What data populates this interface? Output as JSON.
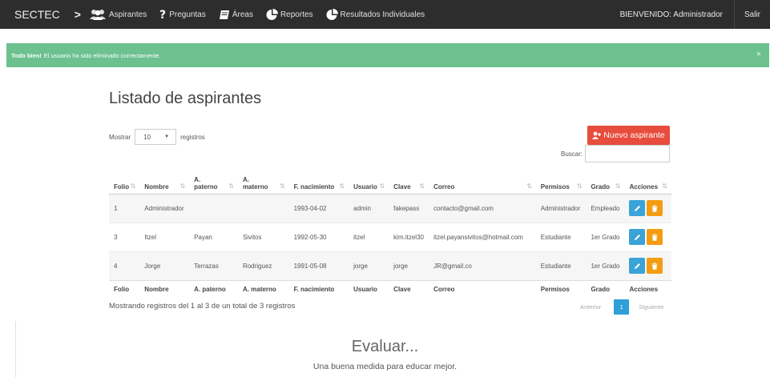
{
  "nav": {
    "brand": "SECTEC",
    "items": [
      {
        "label": "Aspirantes",
        "icon": "users-icon"
      },
      {
        "label": "Preguntas",
        "icon": "question-icon"
      },
      {
        "label": "Áreas",
        "icon": "book-icon"
      },
      {
        "label": "Reportes",
        "icon": "pie-chart-icon"
      },
      {
        "label": "Resultados Individuales",
        "icon": "pie-chart-icon"
      }
    ],
    "welcome": "BIENVENIDO: Administrador",
    "logout": "Salir"
  },
  "alert": {
    "title": "Todo bien!",
    "message": "El usuario ha sido eliminado correctamente.",
    "close": "×",
    "color": "#6cc18e"
  },
  "page": {
    "title": "Listado de aspirantes",
    "length_prefix": "Mostrar",
    "length_value": "10",
    "length_suffix": "registros",
    "new_button": "Nuevo aspirante",
    "search_label": "Buscar:",
    "search_value": ""
  },
  "table": {
    "headers": [
      "Folio",
      "Nombre",
      "A. paterno",
      "A. materno",
      "F. nacimiento",
      "Usuario",
      "Clave",
      "Correo",
      "Permisos",
      "Grado",
      "Acciones"
    ],
    "rows": [
      [
        "1",
        "Administrador",
        "",
        "",
        "1993-04-02",
        "admin",
        "fakepass",
        "contacto@gmail.com",
        "Administrador",
        "Empleado"
      ],
      [
        "3",
        "Itzel",
        "Payan",
        "Sivitos",
        "1992-05-30",
        "itzel",
        "kim.itzel30",
        "itzel.payansivitos@hotmail.com",
        "Estudiante",
        "1er Grado"
      ],
      [
        "4",
        "Jorge",
        "Terrazas",
        "Rodriguez",
        "1991-05-08",
        "jorge",
        "jorge",
        "JR@gmail.co",
        "Estudiante",
        "1er Grado"
      ]
    ],
    "footer": [
      "Folio",
      "Nombre",
      "A. paterno",
      "A. materno",
      "F. nacimiento",
      "Usuario",
      "Clave",
      "Correo",
      "Permisos",
      "Grado",
      "Acciones"
    ]
  },
  "info": "Mostrando registros del 1 al 3 de un total de 3 registros",
  "pager": {
    "prev": "Anterior",
    "current": "1",
    "next": "Siguiente"
  },
  "footer": {
    "title": "Evaluar...",
    "subtitle": "Una buena medida para educar mejor."
  },
  "colors": {
    "navbar": "#2d2d2d",
    "danger": "#e74c3c",
    "edit": "#3aa3d8",
    "delete": "#f39c12",
    "primary": "#2d9fd9"
  }
}
